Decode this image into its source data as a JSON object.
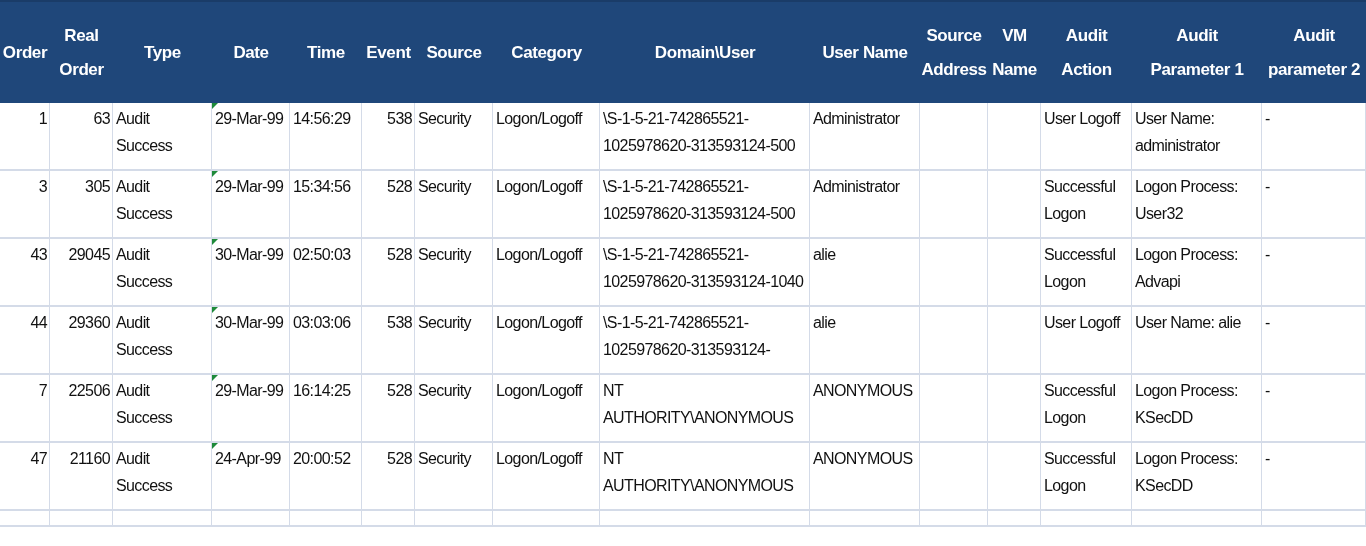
{
  "table": {
    "columns": [
      "Order",
      "Real\nOrder",
      "Type",
      "Date",
      "Time",
      "Event",
      "Source",
      "Category",
      "Domain\\User",
      "User Name",
      "Source\nAddress",
      "VM\nName",
      "Audit\nAction",
      "Audit\nParameter 1",
      "Audit\nparameter 2"
    ],
    "rows": [
      {
        "order": "1",
        "real_order": "63",
        "type": "Audit Success",
        "date": "29-Mar-99",
        "time": "14:56:29",
        "event": "538",
        "source": "Security",
        "category": "Logon/Logoff",
        "domain_user": "\\S-1-5-21-742865521-1025978620-313593124-500",
        "user_name": "Administrator",
        "audit_action": "User Logoff",
        "audit_parameter_1": "User Name: administrator",
        "audit_parameter_2": "-"
      },
      {
        "order": "3",
        "real_order": "305",
        "type": "Audit Success",
        "date": "29-Mar-99",
        "time": "15:34:56",
        "event": "528",
        "source": "Security",
        "category": "Logon/Logoff",
        "domain_user": "\\S-1-5-21-742865521-1025978620-313593124-500",
        "user_name": "Administrator",
        "audit_action": "Successful Logon",
        "audit_parameter_1": "Logon Process:  User32",
        "audit_parameter_2": "-"
      },
      {
        "order": "43",
        "real_order": "29045",
        "type": "Audit Success",
        "date": "30-Mar-99",
        "time": "02:50:03",
        "event": "528",
        "source": "Security",
        "category": "Logon/Logoff",
        "domain_user": "\\S-1-5-21-742865521-1025978620-313593124-1040",
        "user_name": "alie",
        "audit_action": "Successful Logon",
        "audit_parameter_1": "Logon Process:  Advapi",
        "audit_parameter_2": "-"
      },
      {
        "order": "44",
        "real_order": "29360",
        "type": "Audit Success",
        "date": "30-Mar-99",
        "time": "03:03:06",
        "event": "538",
        "source": "Security",
        "category": "Logon/Logoff",
        "domain_user": "\\S-1-5-21-742865521-1025978620-313593124-",
        "user_name": "alie",
        "audit_action": "User Logoff",
        "audit_parameter_1": "User Name: alie",
        "audit_parameter_2": "-"
      },
      {
        "order": "7",
        "real_order": "22506",
        "type": "Audit Success",
        "date": "29-Mar-99",
        "time": "16:14:25",
        "event": "528",
        "source": "Security",
        "category": "Logon/Logoff",
        "domain_user": "NT AUTHORITY\\ANONYMOUS",
        "user_name": "ANONYMOUS",
        "audit_action": "Successful Logon",
        "audit_parameter_1": "Logon Process:  KSecDD",
        "audit_parameter_2": "-"
      },
      {
        "order": "47",
        "real_order": "21160",
        "type": "Audit Success",
        "date": "24-Apr-99",
        "time": "20:00:52",
        "event": "528",
        "source": "Security",
        "category": "Logon/Logoff",
        "domain_user": "NT AUTHORITY\\ANONYMOUS",
        "user_name": "ANONYMOUS",
        "audit_action": "Successful Logon",
        "audit_parameter_1": "Logon Process:  KSecDD",
        "audit_parameter_2": "-"
      }
    ]
  }
}
